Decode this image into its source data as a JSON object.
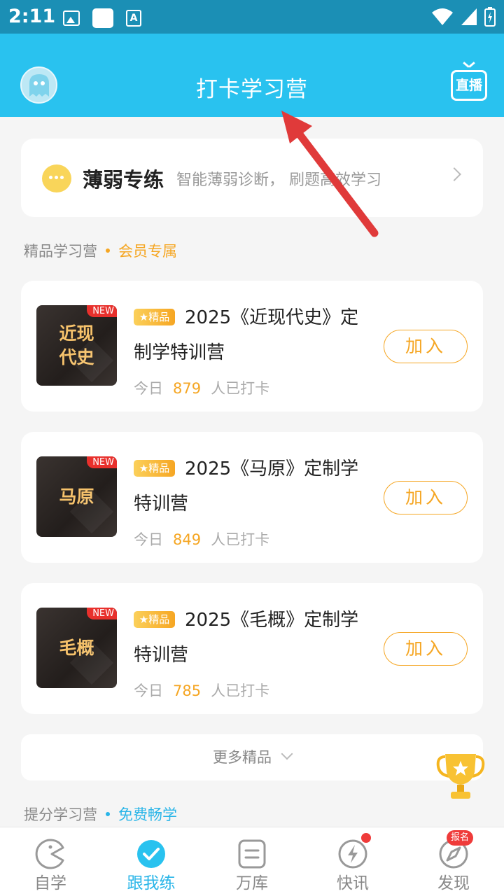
{
  "status_bar": {
    "time": "2:11"
  },
  "header": {
    "title": "打卡学习营",
    "live_label": "直播"
  },
  "weak_practice": {
    "title": "薄弱专练",
    "subtitle": "智能薄弱诊断， 刷题高效学习"
  },
  "premium_section": {
    "label": "精品学习营",
    "tag": "会员专属"
  },
  "courses": [
    {
      "cover_text": "近现代史",
      "badge": "NEW",
      "tag": "精品",
      "title": "2025《近现代史》定制学特训营",
      "stat_prefix": "今日",
      "count": "879",
      "stat_suffix": "人已打卡",
      "join_label": "加入"
    },
    {
      "cover_text": "马原",
      "badge": "NEW",
      "tag": "精品",
      "title": "2025《马原》定制学特训营",
      "stat_prefix": "今日",
      "count": "849",
      "stat_suffix": "人已打卡",
      "join_label": "加入"
    },
    {
      "cover_text": "毛概",
      "badge": "NEW",
      "tag": "精品",
      "title": "2025《毛概》定制学特训营",
      "stat_prefix": "今日",
      "count": "785",
      "stat_suffix": "人已打卡",
      "join_label": "加入"
    }
  ],
  "more": {
    "label": "更多精品"
  },
  "boost_section": {
    "label": "提分学习营",
    "tag": "免费畅学"
  },
  "tabs": [
    {
      "label": "自学",
      "icon": "pacman-icon"
    },
    {
      "label": "跟我练",
      "icon": "check-circle-icon"
    },
    {
      "label": "万库",
      "icon": "document-icon"
    },
    {
      "label": "快讯",
      "icon": "lightning-icon"
    },
    {
      "label": "发现",
      "icon": "compass-icon"
    }
  ],
  "badges": {
    "signup": "报名"
  },
  "colors": {
    "header": "#29c2ef",
    "status_bar": "#1b8fb5",
    "accent_gold": "#f5a623",
    "active_tab": "#29b5e8",
    "badge_red": "#ef3b3a"
  }
}
